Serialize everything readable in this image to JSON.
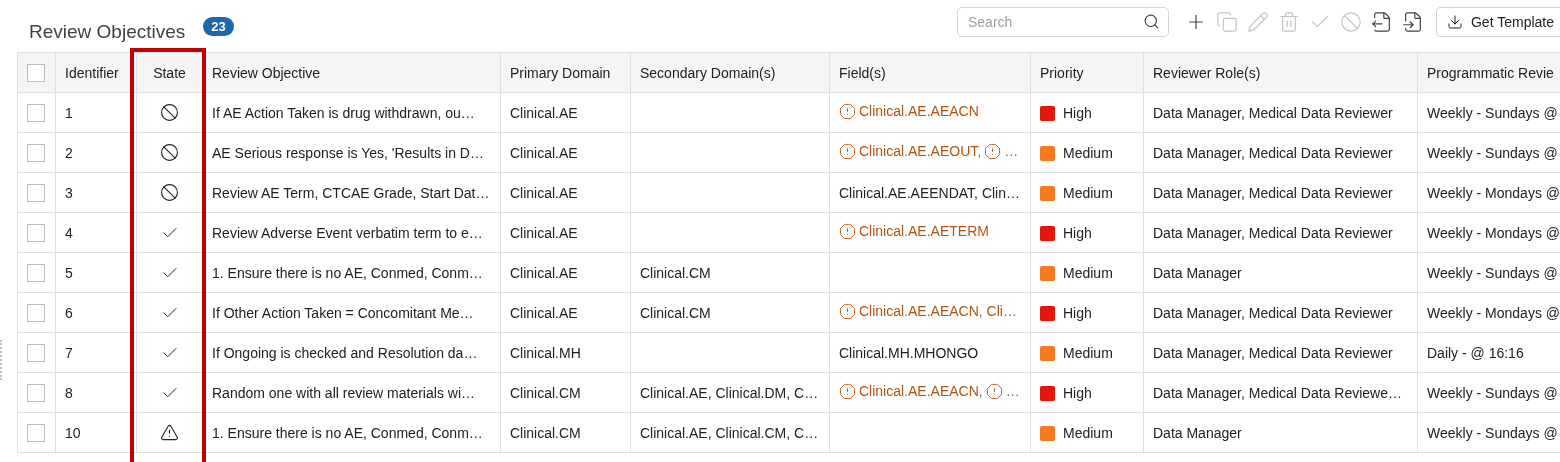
{
  "title": "Review Objectives",
  "count": "23",
  "search": {
    "placeholder": "Search"
  },
  "toolbar": [
    {
      "kind": "add",
      "disabled": false
    },
    {
      "kind": "copy",
      "disabled": true
    },
    {
      "kind": "edit",
      "disabled": true
    },
    {
      "kind": "delete",
      "disabled": true
    },
    {
      "kind": "approve",
      "disabled": true
    },
    {
      "kind": "deactivate",
      "disabled": true
    },
    {
      "kind": "export",
      "disabled": false
    },
    {
      "kind": "import",
      "disabled": false
    }
  ],
  "template_button": "Get Template",
  "table": {
    "select_all_checked": false,
    "columns": [
      "Identifier",
      "State",
      "Review Objective",
      "Primary Domain",
      "Secondary Domain(s)",
      "Field(s)",
      "Priority",
      "Reviewer Role(s)",
      "Programmatic Revie"
    ],
    "rows": [
      {
        "checked": false,
        "id": "1",
        "state": {
          "kind": "inactive"
        },
        "objective": "If AE Action Taken is drug withdrawn, ou…",
        "primary": "Clinical.AE",
        "secondary": "",
        "fields": [
          {
            "text": "Clinical.AE.AEACN",
            "warning": true
          }
        ],
        "priority": "High",
        "color": "#e3170a",
        "roles": "Data Manager, Medical Data Reviewer",
        "schedule": "Weekly - Sundays @"
      },
      {
        "checked": false,
        "id": "2",
        "state": {
          "kind": "inactive"
        },
        "objective": "AE Serious response is Yes, 'Results in D…",
        "primary": "Clinical.AE",
        "secondary": "",
        "fields": [
          {
            "text": "Clinical.AE.AEOUT,",
            "warning": true
          },
          {
            "text": "…",
            "warning": true
          }
        ],
        "priority": "Medium",
        "color": "#f47b20",
        "roles": "Data Manager, Medical Data Reviewer",
        "schedule": "Weekly - Sundays @"
      },
      {
        "checked": false,
        "id": "3",
        "state": {
          "kind": "inactive"
        },
        "objective": "Review AE Term, CTCAE Grade, Start Dat…",
        "primary": "Clinical.AE",
        "secondary": "",
        "fields": [
          {
            "text": "Clinical.AE.AEENDAT, Clin…",
            "warning": false
          }
        ],
        "priority": "Medium",
        "color": "#f47b20",
        "roles": "Data Manager, Medical Data Reviewer",
        "schedule": "Weekly - Mondays @"
      },
      {
        "checked": false,
        "id": "4",
        "state": {
          "kind": "active"
        },
        "objective": "Review Adverse Event verbatim term to e…",
        "primary": "Clinical.AE",
        "secondary": "",
        "fields": [
          {
            "text": "Clinical.AE.AETERM",
            "warning": true
          }
        ],
        "priority": "High",
        "color": "#e3170a",
        "roles": "Data Manager, Medical Data Reviewer",
        "schedule": "Weekly - Mondays @"
      },
      {
        "checked": false,
        "id": "5",
        "state": {
          "kind": "active"
        },
        "objective": "1. Ensure there is no AE, Conmed, Conm…",
        "primary": "Clinical.AE",
        "secondary": "Clinical.CM",
        "fields": [],
        "priority": "Medium",
        "color": "#f47b20",
        "roles": "Data Manager",
        "schedule": "Weekly - Sundays @"
      },
      {
        "checked": false,
        "id": "6",
        "state": {
          "kind": "active"
        },
        "objective": "If Other Action Taken = Concomitant Me…",
        "primary": "Clinical.AE",
        "secondary": "Clinical.CM",
        "fields": [
          {
            "text": "Clinical.AE.AEACN, Cli…",
            "warning": true
          }
        ],
        "priority": "High",
        "color": "#e3170a",
        "roles": "Data Manager, Medical Data Reviewer",
        "schedule": "Weekly - Mondays @"
      },
      {
        "checked": false,
        "id": "7",
        "state": {
          "kind": "active"
        },
        "objective": "If Ongoing is checked and Resolution da…",
        "primary": "Clinical.MH",
        "secondary": "",
        "fields": [
          {
            "text": "Clinical.MH.MHONGO",
            "warning": false
          }
        ],
        "priority": "Medium",
        "color": "#f47b20",
        "roles": "Data Manager, Medical Data Reviewer",
        "schedule": "Daily - @ 16:16"
      },
      {
        "checked": false,
        "id": "8",
        "state": {
          "kind": "active"
        },
        "objective": "Random one with all review materials wi…",
        "primary": "Clinical.CM",
        "secondary": "Clinical.AE, Clinical.DM, C…",
        "fields": [
          {
            "text": "Clinical.AE.AEACN,",
            "warning": true
          },
          {
            "text": "…",
            "warning": true
          }
        ],
        "priority": "High",
        "color": "#e3170a",
        "roles": "Data Manager, Medical Data Reviewe…",
        "schedule": "Weekly - Sundays @"
      },
      {
        "checked": false,
        "id": "10",
        "state": {
          "kind": "warning"
        },
        "objective": "1. Ensure there is no AE, Conmed, Conm…",
        "primary": "Clinical.CM",
        "secondary": "Clinical.AE, Clinical.CM, C…",
        "fields": [],
        "priority": "Medium",
        "color": "#f47b20",
        "roles": "Data Manager",
        "schedule": "Weekly - Sundays @"
      }
    ]
  }
}
